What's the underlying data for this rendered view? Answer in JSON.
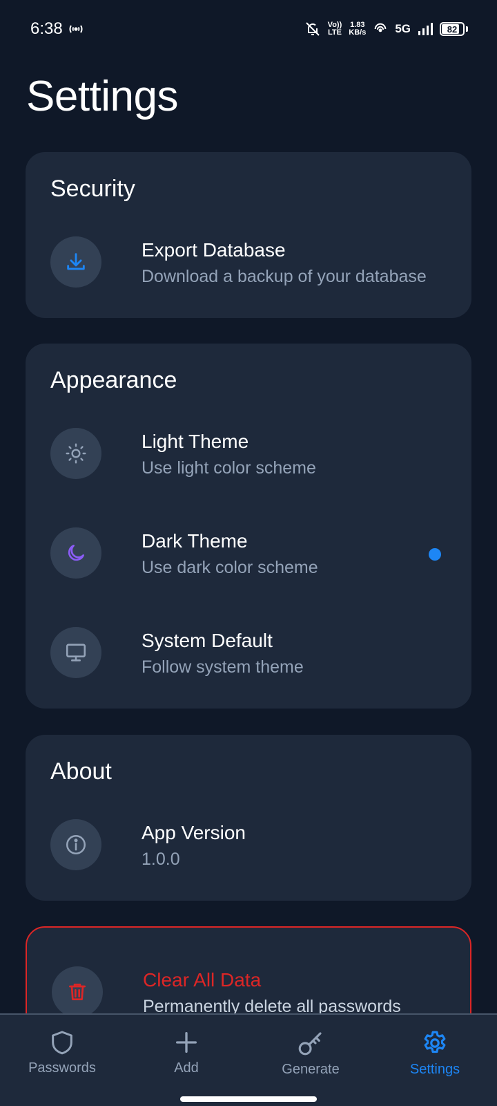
{
  "status_bar": {
    "time": "6:38",
    "network_speed_value": "1.83",
    "network_speed_unit": "KB/s",
    "volte_top": "Vo))",
    "volte_bottom": "LTE",
    "network_type": "5G",
    "battery_level": "82"
  },
  "page": {
    "title": "Settings"
  },
  "sections": {
    "security": {
      "title": "Security",
      "items": [
        {
          "label": "Export Database",
          "description": "Download a backup of your database",
          "icon": "download-icon"
        }
      ]
    },
    "appearance": {
      "title": "Appearance",
      "selected": "Dark Theme",
      "items": [
        {
          "label": "Light Theme",
          "description": "Use light color scheme",
          "icon": "sun-icon"
        },
        {
          "label": "Dark Theme",
          "description": "Use dark color scheme",
          "icon": "moon-icon"
        },
        {
          "label": "System Default",
          "description": "Follow system theme",
          "icon": "monitor-icon"
        }
      ]
    },
    "about": {
      "title": "About",
      "items": [
        {
          "label": "App Version",
          "description": "1.0.0",
          "icon": "info-icon"
        }
      ]
    },
    "danger": {
      "items": [
        {
          "label": "Clear All Data",
          "description": "Permanently delete all passwords",
          "icon": "trash-icon"
        }
      ]
    }
  },
  "bottom_nav": {
    "active": "Settings",
    "items": [
      {
        "label": "Passwords",
        "icon": "shield-icon"
      },
      {
        "label": "Add",
        "icon": "plus-icon"
      },
      {
        "label": "Generate",
        "icon": "key-icon"
      },
      {
        "label": "Settings",
        "icon": "gear-icon"
      }
    ]
  },
  "colors": {
    "background": "#0f1828",
    "card": "#1e293b",
    "icon_circle": "#334155",
    "accent": "#1d86f5",
    "danger": "#dc2626",
    "moon": "#8b5cf6",
    "muted_text": "#94a3b8"
  }
}
